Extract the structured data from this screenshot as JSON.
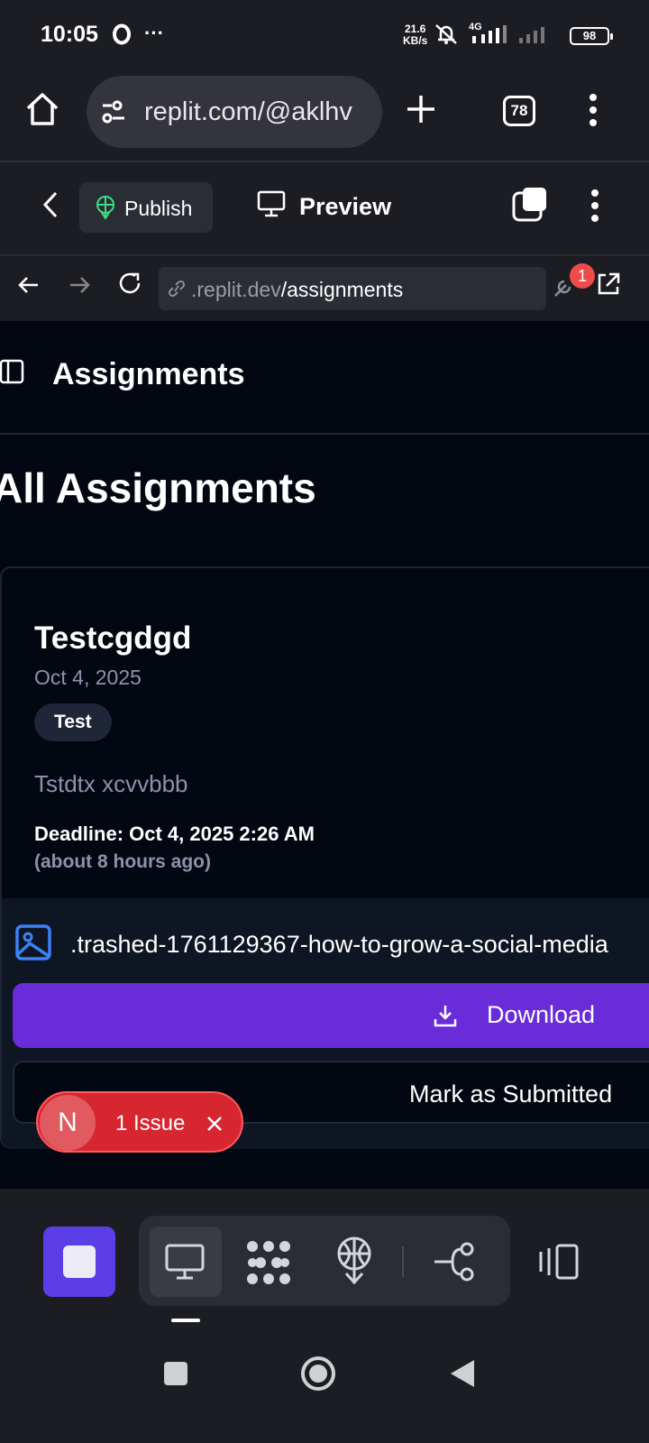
{
  "status_bar": {
    "time": "10:05",
    "net_speed": "21.6",
    "net_unit": "KB/s",
    "network_type": "4G",
    "battery": "98"
  },
  "browser": {
    "url": "replit.com/@aklhv",
    "tab_count": "78"
  },
  "replit_toolbar": {
    "publish_label": "Publish",
    "preview_label": "Preview"
  },
  "inner_browser": {
    "url_domain": ".replit.dev",
    "url_path": "/assignments",
    "issue_badge_count": "1"
  },
  "app": {
    "header_title": "Assignments",
    "page_title": "All Assignments",
    "assignment": {
      "title": "Testcgdgd",
      "date": "Oct 4, 2025",
      "tag": "Test",
      "description": "Tstdtx xcvvbbb",
      "deadline": "Deadline: Oct 4, 2025 2:26 AM",
      "deadline_relative": "(about 8 hours ago)",
      "file_name": ".trashed-1761129367-how-to-grow-a-social-media",
      "download_label": "Download",
      "submit_label": "Mark as Submitted"
    }
  },
  "issue_toast": {
    "avatar_letter": "N",
    "label": "1 Issue"
  },
  "colors": {
    "accent_purple": "#6a2bd9",
    "stop_button": "#5b3ee6",
    "issue_red": "#d7262f",
    "app_background": "#030711"
  }
}
